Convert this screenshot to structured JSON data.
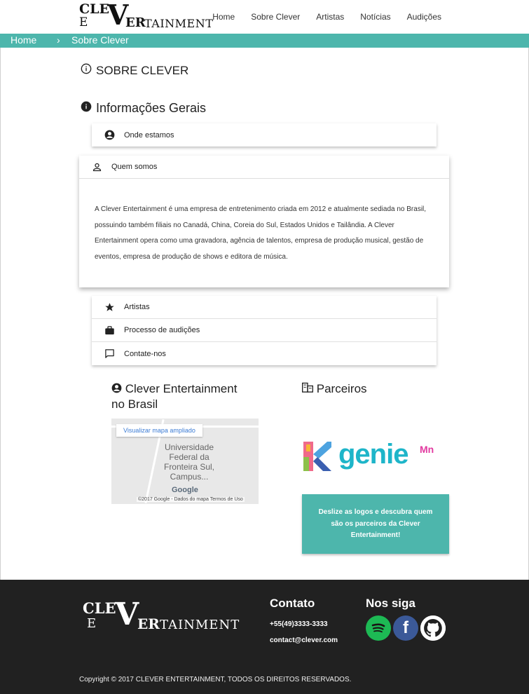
{
  "header": {
    "logo": {
      "l1": "CLE",
      "bigv": "V",
      "l2": "E",
      "l3": "ER",
      "l4": "TAINMENT"
    },
    "nav": [
      "Home",
      "Sobre Clever",
      "Artistas",
      "Notícias",
      "Audições"
    ]
  },
  "breadcrumb": {
    "home": "Home",
    "separator": "›",
    "current": "Sobre Clever"
  },
  "page_title": "SOBRE CLEVER",
  "section_title": "Informações Gerais",
  "collapsible": {
    "top": {
      "label": "Onde estamos",
      "icon": "account-circle-icon"
    },
    "active": {
      "label": "Quem somos",
      "icon": "person-icon",
      "body": "A Clever Entertainment é uma empresa de entretenimento criada em 2012 e atualmente sediada no Brasil, possuindo também filiais no Canadá, China, Coreia do Sul, Estados Unidos e Tailândia. A Clever Entertainment opera como uma gravadora, agência de talentos, empresa de produção musical, gestão de eventos, empresa de produção de shows e editora de música."
    },
    "bottom": [
      {
        "label": "Artistas",
        "icon": "star-icon"
      },
      {
        "label": "Processo de audições",
        "icon": "briefcase-icon"
      },
      {
        "label": "Contate-nos",
        "icon": "chat-icon"
      }
    ]
  },
  "brasil": {
    "title_line1": "Clever Entertainment",
    "title_line2": "no Brasil",
    "map": {
      "button": "Visualizar mapa ampliado",
      "place": "Universidade Federal da Fronteira Sul, Campus...",
      "google": "Google",
      "footer": "©2017 Google - Dados do mapa   Termos de Uso"
    }
  },
  "parceiros": {
    "title": "Parceiros",
    "logo_genie": "genie",
    "logo_mnet": "Mn",
    "cta": "Deslize as logos e descubra quem são os parceiros da Clever Entertainment!"
  },
  "footer": {
    "logo": {
      "l1": "CLE",
      "bigv": "V",
      "l2": "E",
      "l3": "ER",
      "l4": "TAINMENT"
    },
    "contato_title": "Contato",
    "phone": "+55(49)3333-3333",
    "email": "contact@clever.com",
    "siga_title": "Nos siga",
    "social": [
      "spotify-icon",
      "facebook-icon",
      "github-icon"
    ],
    "colors": {
      "spotify_bg": "#1db954",
      "facebook_bg": "#3b5998",
      "github_bg": "#ffffff"
    },
    "copyright": "Copyright © 2017 CLEVER ENTERTAINMENT, TODOS OS DIREITOS RESERVADOS."
  },
  "colors": {
    "accent": "#4db6ac",
    "footer_bg": "#212121"
  }
}
